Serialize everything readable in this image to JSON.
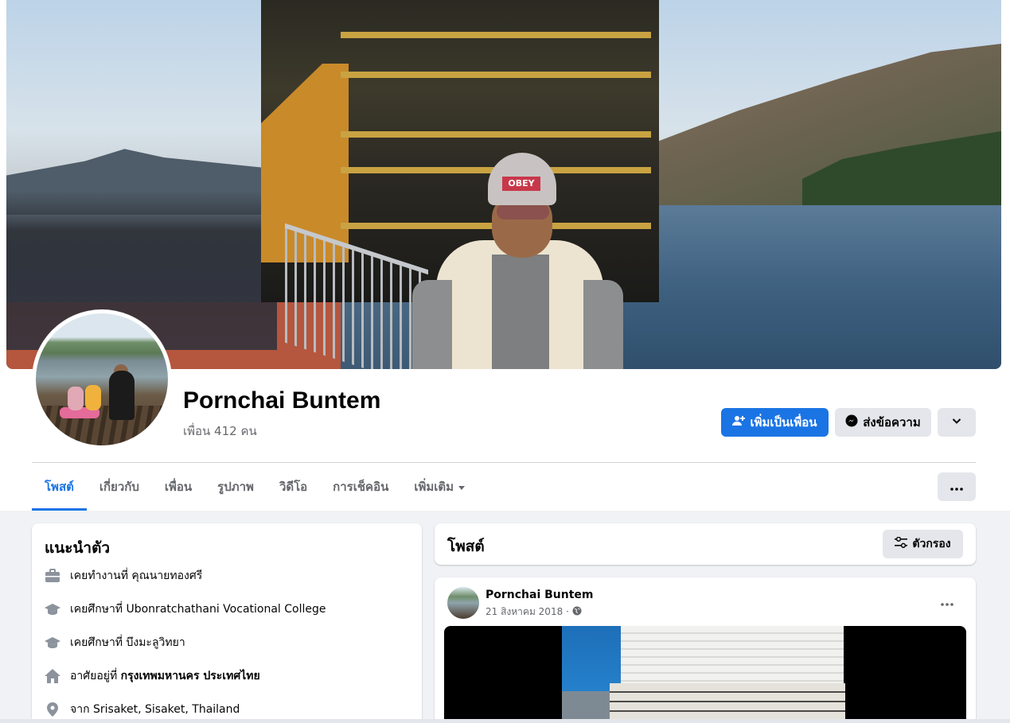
{
  "profile": {
    "name": "Pornchai Buntem",
    "friends": "เพื่อน 412 คน"
  },
  "cover": {
    "hat_text": "OBEY"
  },
  "actions": {
    "add_friend": "เพิ่มเป็นเพื่อน",
    "message": "ส่งข้อความ"
  },
  "tabs": [
    {
      "label": "โพสต์",
      "active": true
    },
    {
      "label": "เกี่ยวกับ",
      "active": false
    },
    {
      "label": "เพื่อน",
      "active": false
    },
    {
      "label": "รูปภาพ",
      "active": false
    },
    {
      "label": "วิดีโอ",
      "active": false
    },
    {
      "label": "การเช็คอิน",
      "active": false
    },
    {
      "label": "เพิ่มเติม",
      "active": false
    }
  ],
  "intro": {
    "title": "แนะนำตัว",
    "items": [
      {
        "icon": "briefcase-icon",
        "prefix": "เคยทำงานที่ คุณนายทองศรี",
        "bold": ""
      },
      {
        "icon": "graduation-cap-icon",
        "prefix": "เคยศึกษาที่ Ubonratchathani Vocational College",
        "bold": ""
      },
      {
        "icon": "graduation-cap-icon",
        "prefix": "เคยศึกษาที่ บึงมะลูวิทยา",
        "bold": ""
      },
      {
        "icon": "home-icon",
        "prefix": "อาศัยอยู่ที่ ",
        "bold": "กรุงเทพมหานคร ประเทศไทย"
      },
      {
        "icon": "location-pin-icon",
        "prefix": "จาก Srisaket, Sisaket, Thailand",
        "bold": ""
      }
    ]
  },
  "posts": {
    "title": "โพสต์",
    "filter_label": "ตัวกรอง",
    "items": [
      {
        "author": "Pornchai Buntem",
        "date": "21 สิงหาคม 2018 ·",
        "privacy_icon": "globe-icon"
      }
    ]
  },
  "colors": {
    "accent": "#1b74e4",
    "page_bg": "#f0f2f5",
    "secondary_text": "#65676b",
    "button_gray": "#e4e6eb"
  }
}
